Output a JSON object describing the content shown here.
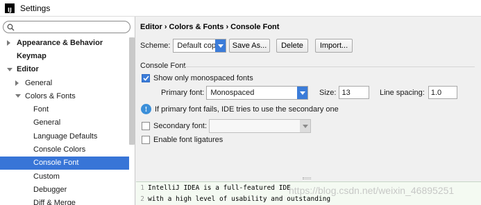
{
  "window": {
    "title": "Settings"
  },
  "search": {
    "placeholder": ""
  },
  "sidebar": {
    "items": [
      {
        "label": "Appearance & Behavior",
        "level": 0,
        "bold": true,
        "arrow": "right"
      },
      {
        "label": "Keymap",
        "level": 0,
        "bold": true,
        "arrow": "none"
      },
      {
        "label": "Editor",
        "level": 0,
        "bold": true,
        "arrow": "down"
      },
      {
        "label": "General",
        "level": 1,
        "bold": false,
        "arrow": "right"
      },
      {
        "label": "Colors & Fonts",
        "level": 1,
        "bold": false,
        "arrow": "down"
      },
      {
        "label": "Font",
        "level": 2,
        "bold": false,
        "arrow": "none"
      },
      {
        "label": "General",
        "level": 2,
        "bold": false,
        "arrow": "none"
      },
      {
        "label": "Language Defaults",
        "level": 2,
        "bold": false,
        "arrow": "none"
      },
      {
        "label": "Console Colors",
        "level": 2,
        "bold": false,
        "arrow": "none"
      },
      {
        "label": "Console Font",
        "level": 2,
        "bold": false,
        "arrow": "none",
        "selected": true
      },
      {
        "label": "Custom",
        "level": 2,
        "bold": false,
        "arrow": "none"
      },
      {
        "label": "Debugger",
        "level": 2,
        "bold": false,
        "arrow": "none"
      },
      {
        "label": "Diff & Merge",
        "level": 2,
        "bold": false,
        "arrow": "none"
      }
    ]
  },
  "main": {
    "breadcrumb": "Editor › Colors & Fonts › Console Font",
    "scheme_label": "Scheme:",
    "scheme_value": "Default copy",
    "save_as_label": "Save As...",
    "delete_label": "Delete",
    "import_label": "Import...",
    "section_title": "Console Font",
    "show_mono_label": "Show only monospaced fonts",
    "show_mono_checked": true,
    "primary_font_label": "Primary font:",
    "primary_font_value": "Monospaced",
    "size_label": "Size:",
    "size_value": "13",
    "line_spacing_label": "Line spacing:",
    "line_spacing_value": "1.0",
    "info_text": "If primary font fails, IDE tries to use the secondary one",
    "secondary_font_label": "Secondary font:",
    "secondary_font_checked": false,
    "secondary_font_value": "",
    "ligatures_label": "Enable font ligatures",
    "ligatures_checked": false
  },
  "preview": {
    "lines": [
      {
        "num": "1",
        "text": "IntelliJ IDEA is a full-featured IDE"
      },
      {
        "num": "2",
        "text": "with a high level of usability and outstanding"
      }
    ]
  },
  "watermark": "https://blog.csdn.net/weixin_46895251",
  "colors": {
    "accent": "#3875d7",
    "sidebar_bg": "#ffffff",
    "panel_bg": "#f0f0f0",
    "preview_bg": "#f4faf2"
  }
}
